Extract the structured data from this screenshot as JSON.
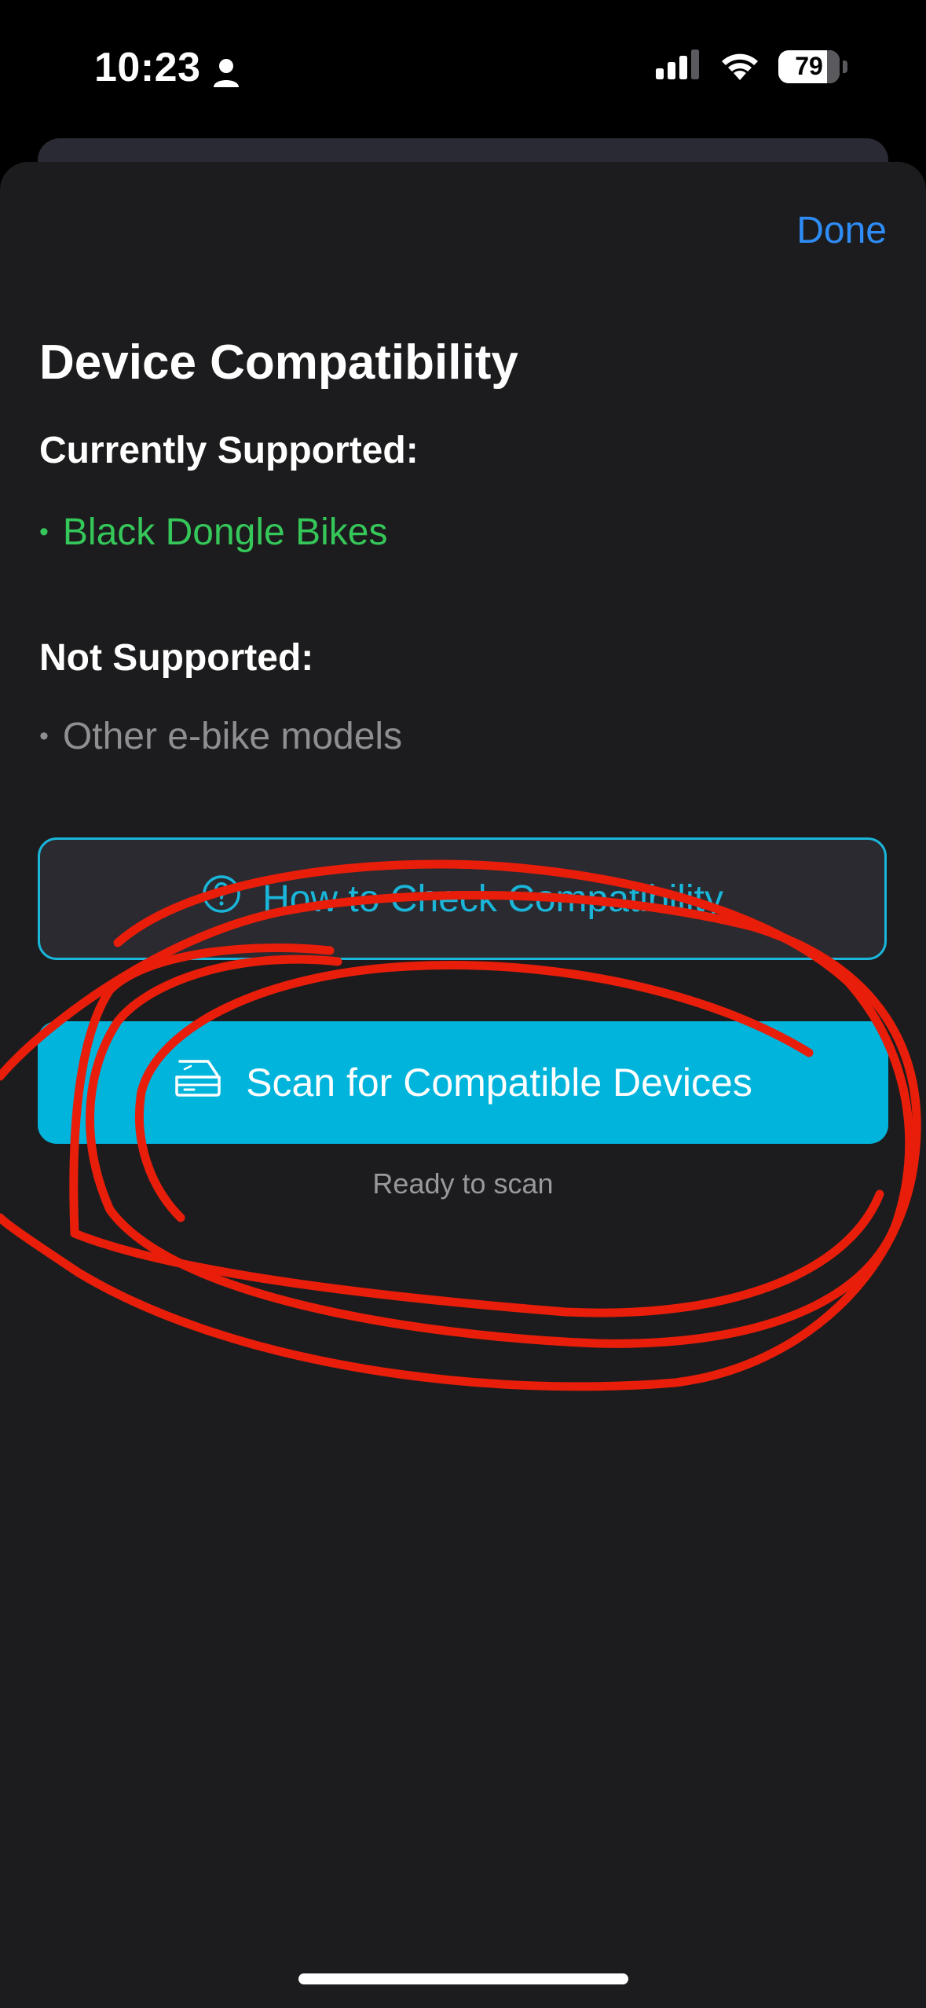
{
  "status_bar": {
    "time": "10:23",
    "battery": "79",
    "battery_level": 0.79
  },
  "sheet": {
    "done_label": "Done",
    "title": "Device Compatibility",
    "supported_heading": "Currently Supported:",
    "supported_items": [
      "Black Dongle Bikes"
    ],
    "unsupported_heading": "Not Supported:",
    "unsupported_items": [
      "Other e-bike models"
    ],
    "bullet": "•",
    "check_button_label": "How to Check Compatibility",
    "scan_button_label": "Scan for Compatible Devices",
    "scan_status": "Ready to scan"
  },
  "colors": {
    "background": "#1c1c1e",
    "accent": "#00b4dc",
    "link": "#2f8cf5",
    "supported": "#35c759",
    "unsupported": "#8e8e93",
    "annotation": "#e81e0a"
  },
  "icons": {
    "person": "person-icon",
    "cellular": "cellular-signal-icon",
    "wifi": "wifi-icon",
    "help": "question-circle-icon",
    "scanner": "scanner-icon"
  }
}
